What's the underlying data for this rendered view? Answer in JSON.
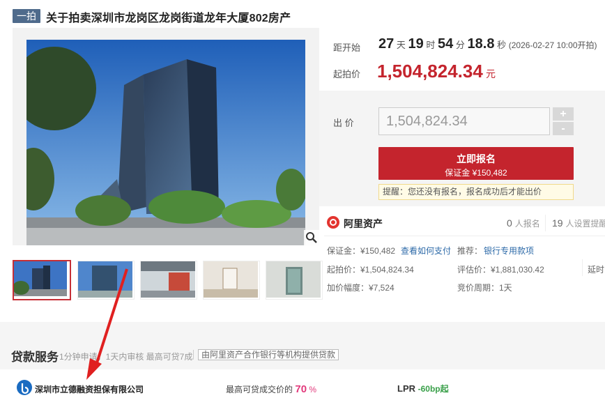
{
  "listing": {
    "tag": "一拍",
    "title": "关于拍卖深圳市龙岗区龙岗街道龙年大厦802房产"
  },
  "countdown": {
    "label": "距开始",
    "days": "27",
    "days_unit": "天",
    "hours": "19",
    "hours_unit": "时",
    "minutes": "54",
    "minutes_unit": "分",
    "seconds": "18.8",
    "seconds_unit": "秒",
    "start_note": "(2026-02-27 10:00开拍)"
  },
  "start_price": {
    "label": "起拍价",
    "value": "1,504,824.34",
    "unit": "元"
  },
  "bid": {
    "label": "出 价",
    "value": "1,504,824.34",
    "plus": "+",
    "minus": "-",
    "signup_label": "立即报名",
    "deposit_line": "保证金 ¥150,482",
    "notice": "提醒：您还没有报名，报名成功后才能出价"
  },
  "platform": {
    "name": "阿里资产",
    "signup_count": "0",
    "signup_label": "人报名",
    "reminder_count": "19",
    "reminder_label": "人设置提醒"
  },
  "details": {
    "deposit": "保证金：¥150,482",
    "how_to_pay": "查看如何支付",
    "recommend_label": "推荐：",
    "recommend_link": "银行专用款项",
    "start_price": "起拍价：¥1,504,824.34",
    "appraisal": "评估价：¥1,881,030.42",
    "delay": "延时",
    "increment": "加价幅度：¥7,524",
    "cycle": "竞价周期：1天"
  },
  "loan": {
    "title": "贷款服务",
    "subtitle": "1分钟申请，1天内审核 最高可贷7成",
    "badge": "由阿里资产合作银行等机构提供贷款",
    "company": "深圳市立德融资担保有限公司",
    "max_label": "最高可贷成交价的",
    "max_value": "70",
    "max_unit": "%",
    "lpr_label": "LPR",
    "lpr_value": "-60bp起"
  },
  "colors": {
    "accent": "#c4242d",
    "link": "#2d6aa8",
    "tag": "#4f6b8c",
    "lpr": "#3aa04a"
  }
}
